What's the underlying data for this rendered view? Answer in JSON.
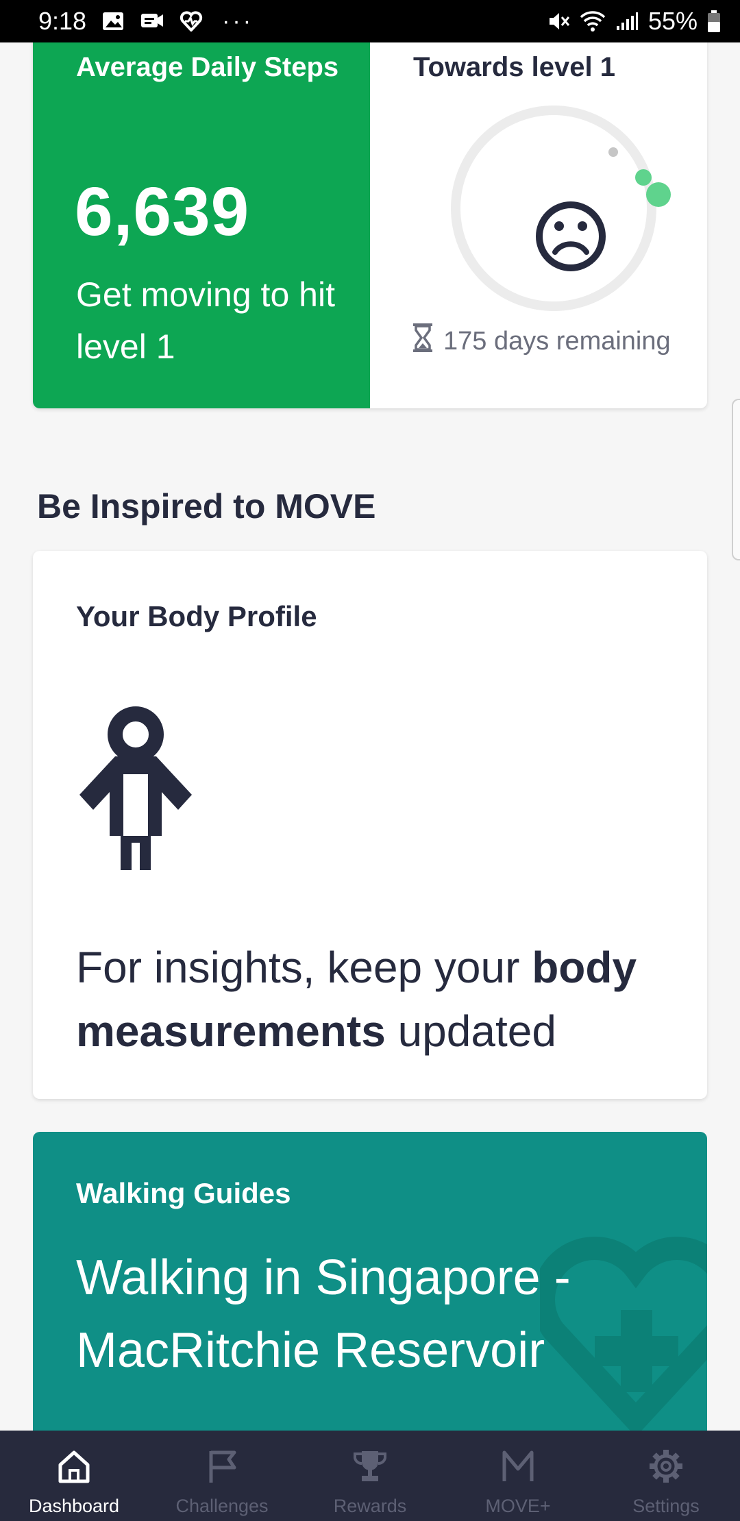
{
  "status_bar": {
    "time": "9:18",
    "battery": "55%",
    "icons": [
      "image-icon",
      "video-message-icon",
      "heart-rate-icon",
      "more-icon",
      "mute-icon",
      "wifi-icon",
      "signal-icon",
      "battery-icon"
    ]
  },
  "steps": {
    "label": "Average Daily Steps",
    "value": "6,639",
    "message": "Get moving to hit level 1",
    "towards_label": "Towards level 1",
    "days_remaining": "175 days remaining",
    "progress_fraction": 0.03
  },
  "section": {
    "title": "Be Inspired to MOVE"
  },
  "body_profile": {
    "title": "Your Body Profile",
    "text_pre": "For insights, keep your ",
    "text_bold1": "body",
    "text_bold2": "measurements",
    "text_post": " updated"
  },
  "walking": {
    "label": "Walking Guides",
    "title": "Walking in Singapore - MacRitchie Reservoir"
  },
  "tabs": [
    {
      "label": "Dashboard",
      "icon": "home-icon",
      "active": true
    },
    {
      "label": "Challenges",
      "icon": "flag-icon",
      "active": false
    },
    {
      "label": "Rewards",
      "icon": "trophy-icon",
      "active": false
    },
    {
      "label": "MOVE+",
      "icon": "move-plus-icon",
      "active": false
    },
    {
      "label": "Settings",
      "icon": "gear-icon",
      "active": false
    }
  ],
  "colors": {
    "green": "#0da653",
    "teal": "#0f8f86",
    "navy": "#272a3d",
    "ring_track": "#ececec",
    "ring_progress": "#5fd38d"
  }
}
